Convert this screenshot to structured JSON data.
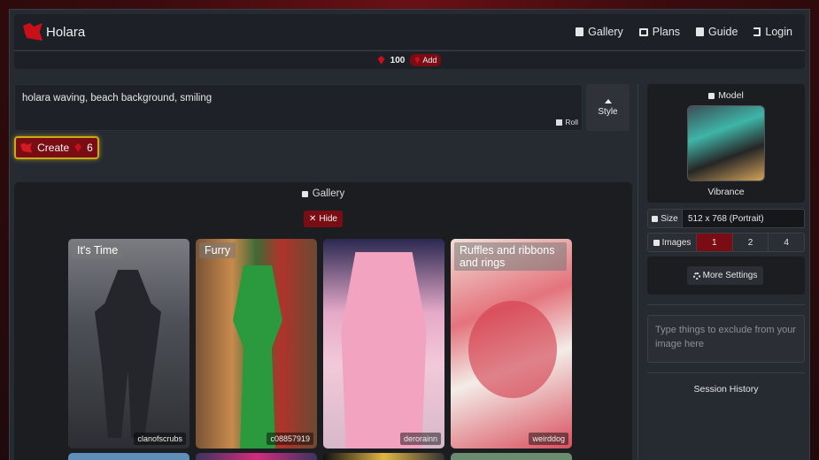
{
  "app": {
    "name": "Holara",
    "brand_color": "#c8101a"
  },
  "nav": {
    "links": [
      {
        "label": "Gallery",
        "icon": "book-icon"
      },
      {
        "label": "Plans",
        "icon": "images-icon"
      },
      {
        "label": "Guide",
        "icon": "document-icon"
      },
      {
        "label": "Login",
        "icon": "login-icon"
      }
    ]
  },
  "gems": {
    "count": "100",
    "add_label": "Add"
  },
  "prompt": {
    "text": "holara waving, beach background, smiling",
    "roll_label": "Roll",
    "style_label": "Style"
  },
  "create": {
    "label": "Create",
    "cost": "6"
  },
  "gallery": {
    "title": "Gallery",
    "hide_label": "Hide",
    "cards": [
      {
        "title": "It's Time",
        "user": "clanofscrubs"
      },
      {
        "title": "Furry",
        "user": "c08857919"
      },
      {
        "title": "",
        "user": "derorainn"
      },
      {
        "title": "Ruffles and ribbons and rings",
        "user": "weirddog"
      }
    ]
  },
  "sidebar": {
    "model_label": "Model",
    "model_name": "Vibrance",
    "size_label": "Size",
    "size_value": "512 x 768 (Portrait)",
    "images_label": "Images",
    "image_options": [
      "1",
      "2",
      "4"
    ],
    "images_selected": "1",
    "more_settings_label": "More Settings",
    "negative_placeholder": "Type things to exclude from your image here",
    "history_label": "Session History"
  }
}
